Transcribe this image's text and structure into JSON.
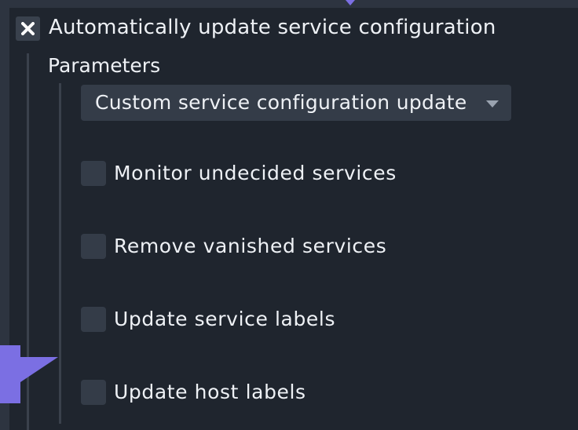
{
  "top_setting": {
    "label": "Automatically update service configuration",
    "checked": true,
    "check_icon": "close-x-icon"
  },
  "parameters": {
    "label": "Parameters",
    "mode_select": {
      "value": "Custom service configuration update",
      "icon": "caret-down-icon"
    },
    "options": [
      {
        "label": "Monitor undecided services",
        "checked": false
      },
      {
        "label": "Remove vanished services",
        "checked": false
      },
      {
        "label": "Update service labels",
        "checked": false
      },
      {
        "label": "Update host labels",
        "checked": false
      }
    ]
  },
  "tooltip": {
    "text": "!"
  },
  "colors": {
    "background": "#1f252e",
    "control": "#343c48",
    "accent": "#7b6fe3",
    "text": "#eef1f5"
  }
}
